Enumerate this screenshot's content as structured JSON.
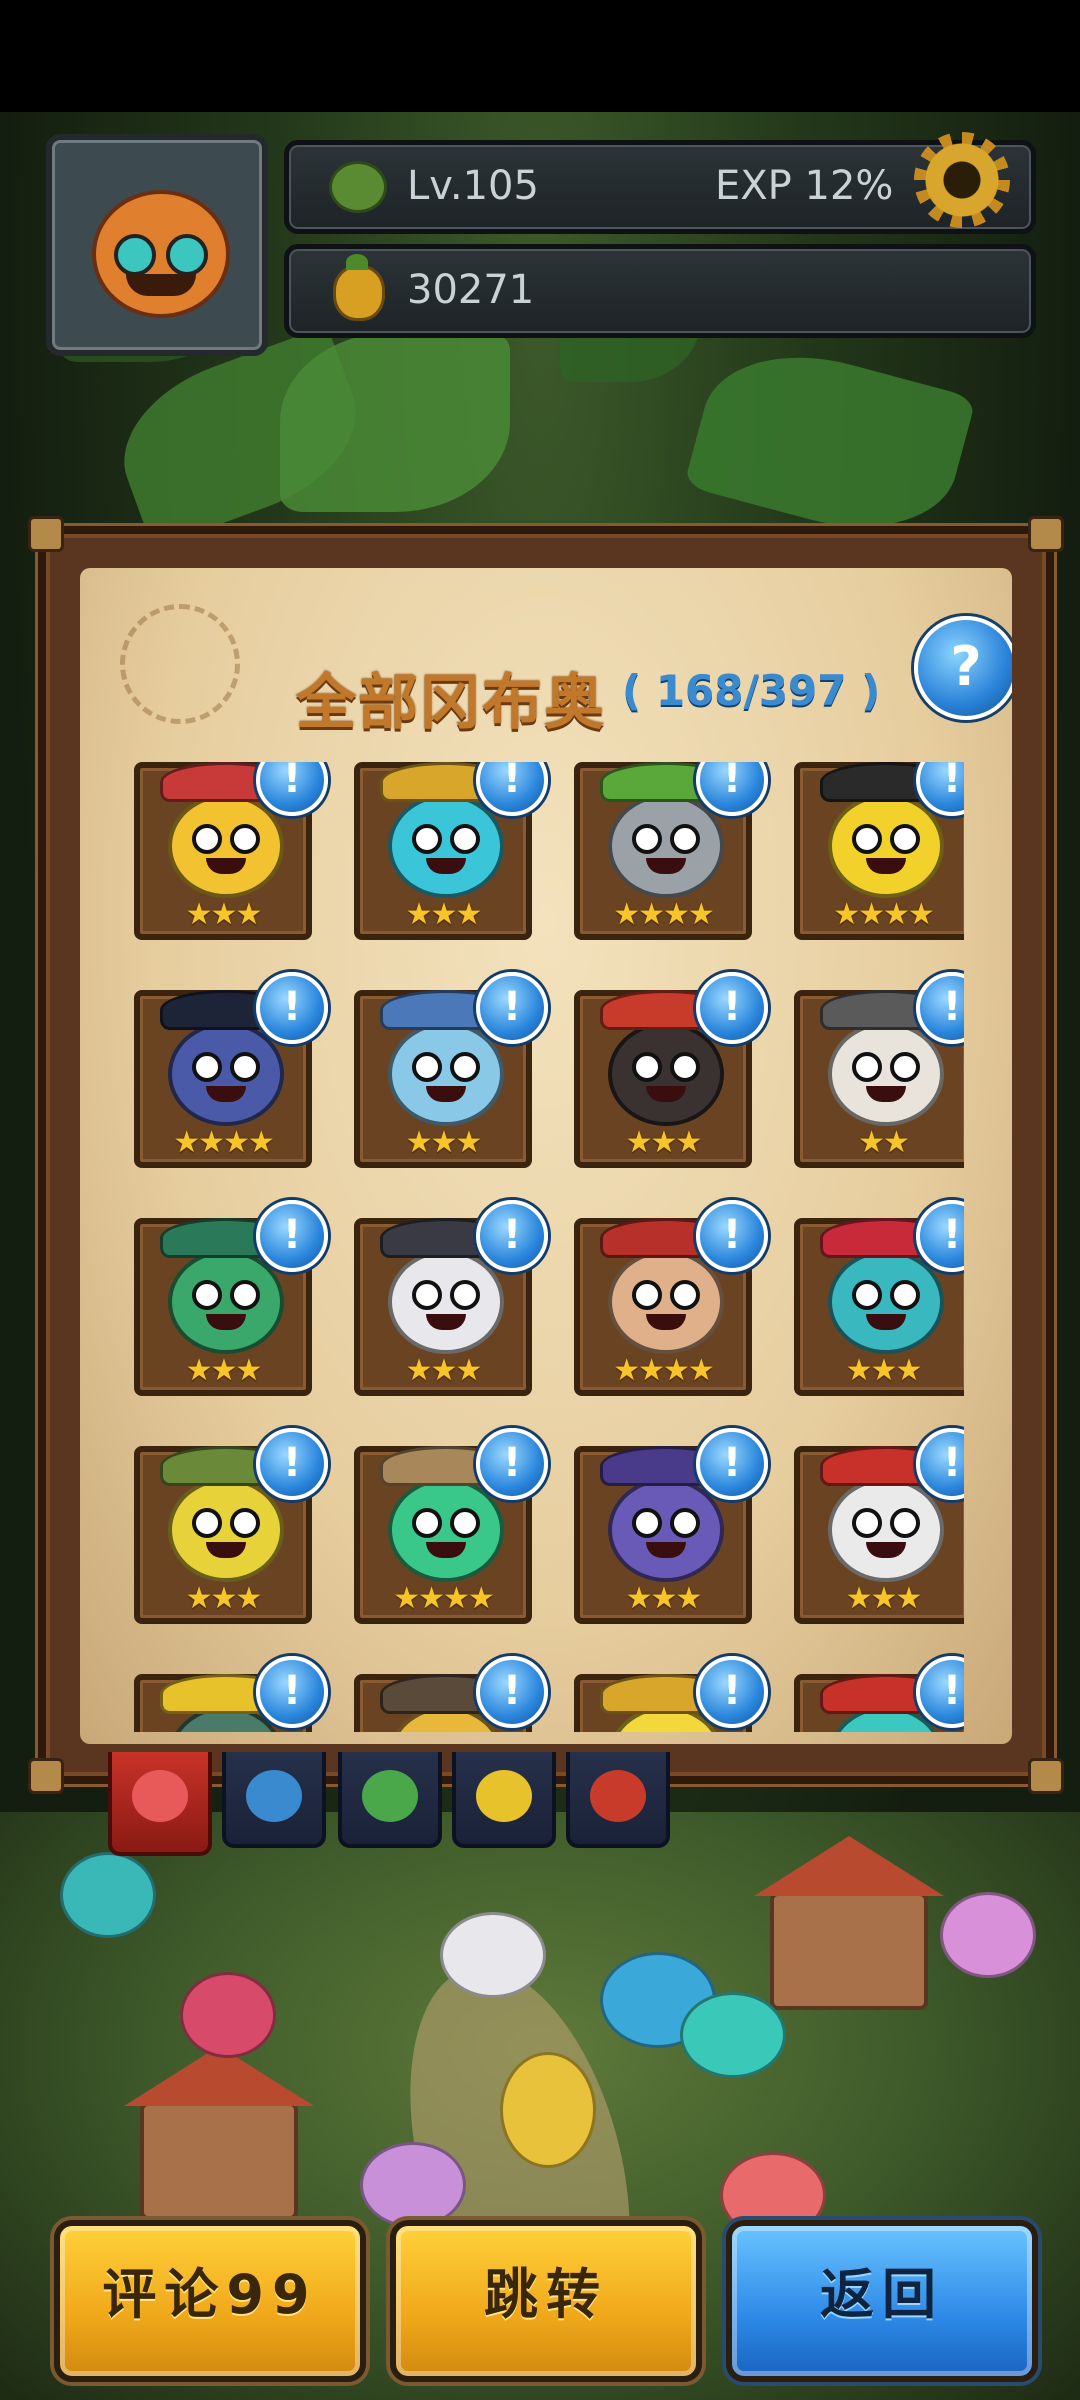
{
  "header": {
    "level": "Lv.105",
    "exp": "EXP 12%",
    "coins": "30271"
  },
  "collection": {
    "title": "全部冈布奥",
    "count": "( 168/397 )",
    "help_label": "?",
    "badge_label": "!",
    "cards": [
      {
        "stars": "★★★",
        "color": "#f2c230",
        "hat": "#c83a3a"
      },
      {
        "stars": "★★★",
        "color": "#3ac6d8",
        "hat": "#d8a62a"
      },
      {
        "stars": "★★★★",
        "color": "#9aa2a8",
        "hat": "#5aa83a"
      },
      {
        "stars": "★★★★",
        "color": "#f2d22a",
        "hat": "#2a2a2a"
      },
      {
        "stars": "★★★★",
        "color": "#4a5aa8",
        "hat": "#1e2438"
      },
      {
        "stars": "★★★",
        "color": "#8ac8e8",
        "hat": "#4a78b8"
      },
      {
        "stars": "★★★",
        "color": "#3a3230",
        "hat": "#c83a2a"
      },
      {
        "stars": "★★",
        "color": "#e8e4dc",
        "hat": "#5a5a5a"
      },
      {
        "stars": "★★★",
        "color": "#3aa86a",
        "hat": "#2a7a5a"
      },
      {
        "stars": "★★★",
        "color": "#e8e8ec",
        "hat": "#3a3a44"
      },
      {
        "stars": "★★★★",
        "color": "#e0b08a",
        "hat": "#b8302a"
      },
      {
        "stars": "★★★",
        "color": "#3ab8c0",
        "hat": "#c82a3a"
      },
      {
        "stars": "★★★",
        "color": "#e8d23a",
        "hat": "#6a8a3a"
      },
      {
        "stars": "★★★★",
        "color": "#3ac88a",
        "hat": "#a8885a"
      },
      {
        "stars": "★★★",
        "color": "#6a5ab8",
        "hat": "#4a3a8a"
      },
      {
        "stars": "★★★",
        "color": "#eaeaea",
        "hat": "#c8302a"
      },
      {
        "stars": "",
        "color": "#4a7a6a",
        "hat": "#e8c22a"
      },
      {
        "stars": "",
        "color": "#e8b83a",
        "hat": "#5a4a3a"
      },
      {
        "stars": "",
        "color": "#f2d83a",
        "hat": "#d8a62a"
      },
      {
        "stars": "",
        "color": "#3ac8c0",
        "hat": "#c8302a"
      }
    ]
  },
  "tabs": [
    {
      "icon": "all-monsters-icon",
      "color": "#e85a5a"
    },
    {
      "icon": "blue-tribe-icon",
      "color": "#3a8ad0"
    },
    {
      "icon": "green-tribe-icon",
      "color": "#4aa84a"
    },
    {
      "icon": "yellow-tribe-icon",
      "color": "#e8c22a"
    },
    {
      "icon": "red-tribe-icon",
      "color": "#c83a2a"
    }
  ],
  "buttons": {
    "comment": "评论99",
    "jump": "跳转",
    "back": "返回"
  }
}
